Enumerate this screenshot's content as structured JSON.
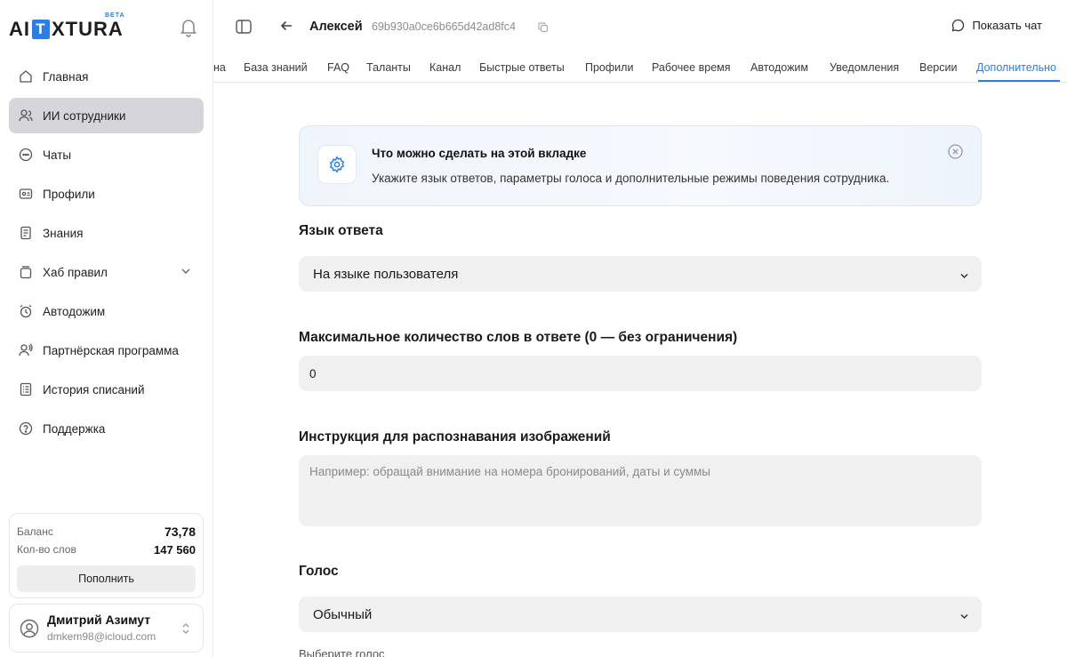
{
  "brand": {
    "logo_left": "AI",
    "logo_mid": "T",
    "logo_right": "XTURA",
    "beta": "BETA"
  },
  "sidebar": {
    "items": [
      {
        "label": "Главная",
        "icon": "home-icon"
      },
      {
        "label": "ИИ сотрудники",
        "icon": "users-icon",
        "active": true
      },
      {
        "label": "Чаты",
        "icon": "chat-icon"
      },
      {
        "label": "Профили",
        "icon": "profile-card-icon"
      },
      {
        "label": "Знания",
        "icon": "document-icon"
      },
      {
        "label": "Хаб правил",
        "icon": "rules-hub-icon",
        "expandable": true
      },
      {
        "label": "Автодожим",
        "icon": "alarm-clock-icon"
      },
      {
        "label": "Партнёрская программа",
        "icon": "partner-icon"
      },
      {
        "label": "История списаний",
        "icon": "history-icon"
      },
      {
        "label": "Поддержка",
        "icon": "help-icon"
      }
    ],
    "balance": {
      "balance_label": "Баланс",
      "balance_value": "73,78",
      "words_label": "Кол-во слов",
      "words_value": "147 560",
      "topup_label": "Пополнить"
    },
    "user": {
      "name": "Дмитрий Азимут",
      "email": "dmkem98@icloud.com"
    }
  },
  "header": {
    "employee_name": "Алексей",
    "employee_id": "69b930a0ce6b665d42ad8fc4",
    "show_chat": "Показать чат"
  },
  "tabs": [
    "на",
    "База знаний",
    "FAQ",
    "Таланты",
    "Канал",
    "Быстрые ответы",
    "Профили",
    "Рабочее время",
    "Автодожим",
    "Уведомления",
    "Версии",
    "Дополнительно"
  ],
  "active_tab": "Дополнительно",
  "info": {
    "title": "Что можно сделать на этой вкладке",
    "description": "Укажите язык ответов, параметры голоса и дополнительные режимы поведения сотрудника."
  },
  "form": {
    "language_label": "Язык ответа",
    "language_value": "На языке пользователя",
    "max_words_label": "Максимальное количество слов в ответе (0 — без ограничения)",
    "max_words_value": "0",
    "image_instruction_label": "Инструкция для распознавания изображений",
    "image_instruction_placeholder": "Например: обращай внимание на номера бронирований, даты и суммы",
    "voice_label": "Голос",
    "voice_value": "Обычный",
    "voice_hint": "Выберите голос"
  },
  "colors": {
    "accent": "#2b7de9",
    "active_nav": "#d6d6da",
    "field_bg": "#f0f0f0"
  }
}
